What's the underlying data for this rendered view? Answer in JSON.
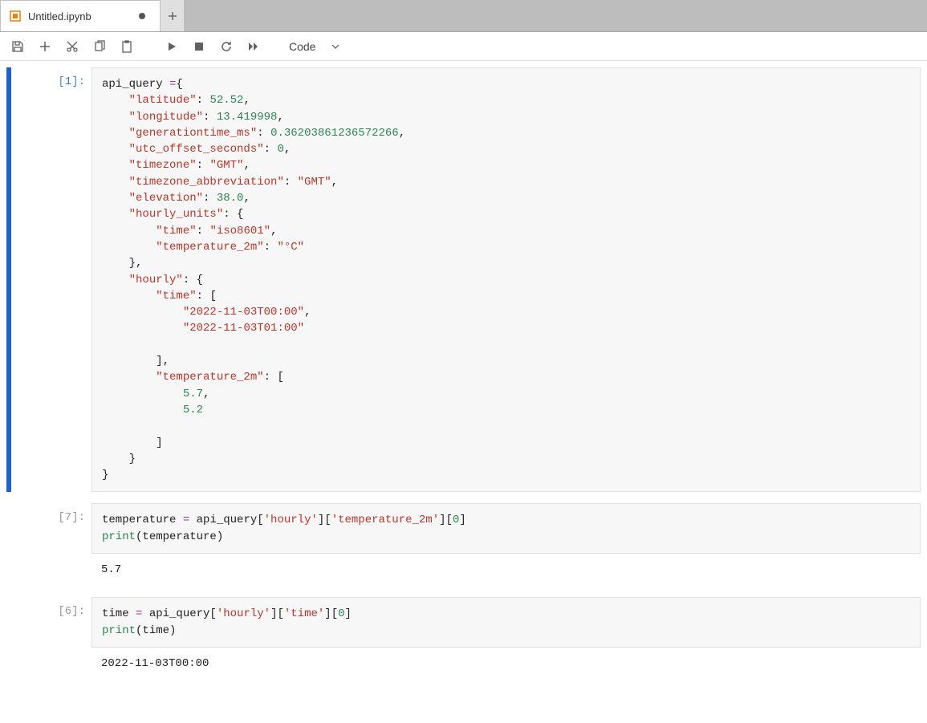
{
  "tab": {
    "title": "Untitled.ipynb",
    "dirty": true
  },
  "toolbar": {
    "cell_type_label": "Code"
  },
  "cells": [
    {
      "exec_count": "1",
      "selected": true,
      "tokens": [
        [
          "name",
          "api_query "
        ],
        [
          "op",
          "="
        ],
        [
          "punc",
          "{"
        ],
        [
          "nl",
          ""
        ],
        [
          "pad",
          "    "
        ],
        [
          "str",
          "\"latitude\""
        ],
        [
          "punc",
          ": "
        ],
        [
          "num",
          "52.52"
        ],
        [
          "punc",
          ","
        ],
        [
          "nl",
          ""
        ],
        [
          "pad",
          "    "
        ],
        [
          "str",
          "\"longitude\""
        ],
        [
          "punc",
          ": "
        ],
        [
          "num",
          "13.419998"
        ],
        [
          "punc",
          ","
        ],
        [
          "nl",
          ""
        ],
        [
          "pad",
          "    "
        ],
        [
          "str",
          "\"generationtime_ms\""
        ],
        [
          "punc",
          ": "
        ],
        [
          "num",
          "0.36203861236572266"
        ],
        [
          "punc",
          ","
        ],
        [
          "nl",
          ""
        ],
        [
          "pad",
          "    "
        ],
        [
          "str",
          "\"utc_offset_seconds\""
        ],
        [
          "punc",
          ": "
        ],
        [
          "num",
          "0"
        ],
        [
          "punc",
          ","
        ],
        [
          "nl",
          ""
        ],
        [
          "pad",
          "    "
        ],
        [
          "str",
          "\"timezone\""
        ],
        [
          "punc",
          ": "
        ],
        [
          "str",
          "\"GMT\""
        ],
        [
          "punc",
          ","
        ],
        [
          "nl",
          ""
        ],
        [
          "pad",
          "    "
        ],
        [
          "str",
          "\"timezone_abbreviation\""
        ],
        [
          "punc",
          ": "
        ],
        [
          "str",
          "\"GMT\""
        ],
        [
          "punc",
          ","
        ],
        [
          "nl",
          ""
        ],
        [
          "pad",
          "    "
        ],
        [
          "str",
          "\"elevation\""
        ],
        [
          "punc",
          ": "
        ],
        [
          "num",
          "38.0"
        ],
        [
          "punc",
          ","
        ],
        [
          "nl",
          ""
        ],
        [
          "pad",
          "    "
        ],
        [
          "str",
          "\"hourly_units\""
        ],
        [
          "punc",
          ": {"
        ],
        [
          "nl",
          ""
        ],
        [
          "pad",
          "        "
        ],
        [
          "str",
          "\"time\""
        ],
        [
          "punc",
          ": "
        ],
        [
          "str",
          "\"iso8601\""
        ],
        [
          "punc",
          ","
        ],
        [
          "nl",
          ""
        ],
        [
          "pad",
          "        "
        ],
        [
          "str",
          "\"temperature_2m\""
        ],
        [
          "punc",
          ": "
        ],
        [
          "str",
          "\"°C\""
        ],
        [
          "nl",
          ""
        ],
        [
          "pad",
          "    "
        ],
        [
          "punc",
          "},"
        ],
        [
          "nl",
          ""
        ],
        [
          "pad",
          "    "
        ],
        [
          "str",
          "\"hourly\""
        ],
        [
          "punc",
          ": {"
        ],
        [
          "nl",
          ""
        ],
        [
          "pad",
          "        "
        ],
        [
          "str",
          "\"time\""
        ],
        [
          "punc",
          ": ["
        ],
        [
          "nl",
          ""
        ],
        [
          "pad",
          "            "
        ],
        [
          "str",
          "\"2022-11-03T00:00\""
        ],
        [
          "punc",
          ","
        ],
        [
          "nl",
          ""
        ],
        [
          "pad",
          "            "
        ],
        [
          "str",
          "\"2022-11-03T01:00\""
        ],
        [
          "nl",
          ""
        ],
        [
          "nl",
          ""
        ],
        [
          "pad",
          "        "
        ],
        [
          "punc",
          "],"
        ],
        [
          "nl",
          ""
        ],
        [
          "pad",
          "        "
        ],
        [
          "str",
          "\"temperature_2m\""
        ],
        [
          "punc",
          ": ["
        ],
        [
          "nl",
          ""
        ],
        [
          "pad",
          "            "
        ],
        [
          "num",
          "5.7"
        ],
        [
          "punc",
          ","
        ],
        [
          "nl",
          ""
        ],
        [
          "pad",
          "            "
        ],
        [
          "num",
          "5.2"
        ],
        [
          "nl",
          ""
        ],
        [
          "nl",
          ""
        ],
        [
          "pad",
          "        "
        ],
        [
          "punc",
          "]"
        ],
        [
          "nl",
          ""
        ],
        [
          "pad",
          "    "
        ],
        [
          "punc",
          "}"
        ],
        [
          "nl",
          ""
        ],
        [
          "punc",
          "}"
        ]
      ],
      "output": ""
    },
    {
      "exec_count": "7",
      "selected": false,
      "tokens": [
        [
          "name",
          "temperature "
        ],
        [
          "op",
          "="
        ],
        [
          "name",
          " api_query["
        ],
        [
          "str",
          "'hourly'"
        ],
        [
          "name",
          "]["
        ],
        [
          "str",
          "'temperature_2m'"
        ],
        [
          "name",
          "]["
        ],
        [
          "num",
          "0"
        ],
        [
          "name",
          "]"
        ],
        [
          "nl",
          ""
        ],
        [
          "fn",
          "print"
        ],
        [
          "name",
          "(temperature)"
        ]
      ],
      "output": "5.7"
    },
    {
      "exec_count": "6",
      "selected": false,
      "tokens": [
        [
          "name",
          "time "
        ],
        [
          "op",
          "="
        ],
        [
          "name",
          " api_query["
        ],
        [
          "str",
          "'hourly'"
        ],
        [
          "name",
          "]["
        ],
        [
          "str",
          "'time'"
        ],
        [
          "name",
          "]["
        ],
        [
          "num",
          "0"
        ],
        [
          "name",
          "]"
        ],
        [
          "nl",
          ""
        ],
        [
          "fn",
          "print"
        ],
        [
          "name",
          "(time)"
        ]
      ],
      "output": "2022-11-03T00:00"
    }
  ]
}
